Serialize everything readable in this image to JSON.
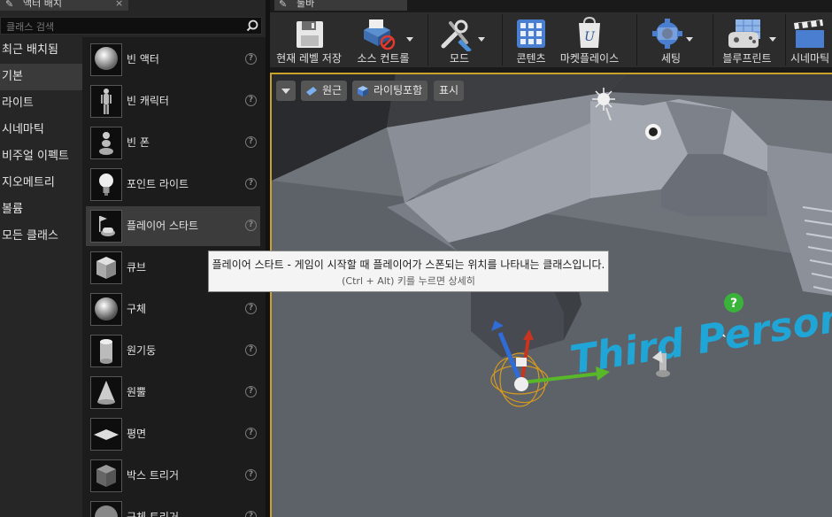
{
  "left_panel": {
    "tab_title": "액터 배치",
    "search_placeholder": "클래스 검색",
    "categories": [
      "최근 배치됨",
      "기본",
      "라이트",
      "시네마틱",
      "비주얼 이펙트",
      "지오메트리",
      "볼륨",
      "모든 클래스"
    ],
    "active_category": "기본",
    "items": [
      {
        "label": "빈 액터",
        "icon": "sphere-icon"
      },
      {
        "label": "빈 캐릭터",
        "icon": "character-icon"
      },
      {
        "label": "빈 폰",
        "icon": "pawn-icon"
      },
      {
        "label": "포인트 라이트",
        "icon": "lightbulb-icon"
      },
      {
        "label": "플레이어 스타트",
        "icon": "player-start-icon"
      },
      {
        "label": "큐브",
        "icon": "cube-icon"
      },
      {
        "label": "구체",
        "icon": "sphere-icon"
      },
      {
        "label": "원기둥",
        "icon": "cylinder-icon"
      },
      {
        "label": "원뿔",
        "icon": "cone-icon"
      },
      {
        "label": "평면",
        "icon": "plane-icon"
      },
      {
        "label": "박스 트리거",
        "icon": "box-trigger-icon"
      },
      {
        "label": "구체 트리거",
        "icon": "sphere-trigger-icon"
      }
    ]
  },
  "toolbar": {
    "tab_title": "툴바",
    "buttons": [
      {
        "label": "현재 레벨 저장",
        "icon": "save-icon"
      },
      {
        "label": "소스 컨트롤",
        "icon": "source-control-icon"
      },
      {
        "label": "모드",
        "icon": "modes-icon"
      },
      {
        "label": "콘텐츠",
        "icon": "content-icon"
      },
      {
        "label": "마켓플레이스",
        "icon": "marketplace-icon"
      },
      {
        "label": "세팅",
        "icon": "settings-icon"
      },
      {
        "label": "블루프린트",
        "icon": "blueprint-icon"
      },
      {
        "label": "시네마틱",
        "icon": "cinematics-icon"
      }
    ]
  },
  "viewport": {
    "perspective_label": "원근",
    "lighting_label": "라이팅포함",
    "show_label": "표시",
    "text_render": "Third Person"
  },
  "tooltip": {
    "title": "플레이어 스타트 - 게임이 시작할 때 플레이어가 스폰되는 위치를 나타내는 클래스입니다.",
    "hint": "(Ctrl + Alt) 키를 누르면 상세히"
  },
  "colors": {
    "accent_border": "#c9a227",
    "text_render_color": "#22a8d8",
    "highlight_bg": "#3c3c3c"
  }
}
